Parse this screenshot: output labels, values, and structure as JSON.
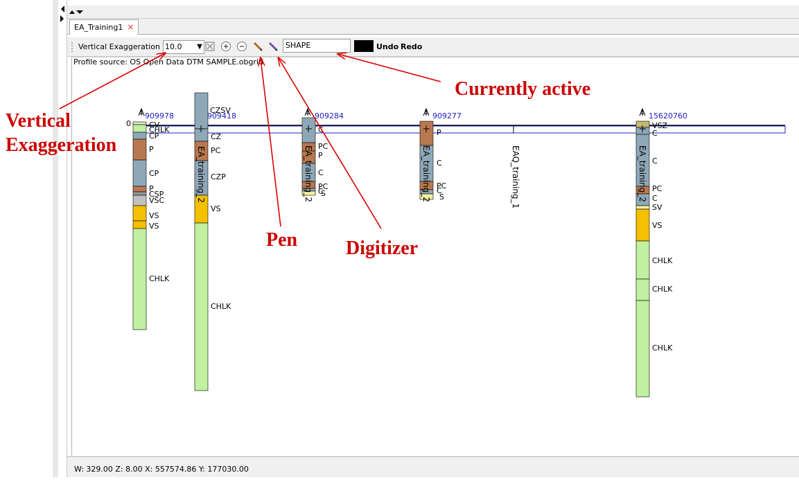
{
  "window": {
    "tab_label": "EA_Training1",
    "close_glyph": "×"
  },
  "toolbar": {
    "ve_label": "Vertical Exaggeration",
    "ve_value": "10.0",
    "shape_value": "SHAPE",
    "undo_label": "Undo",
    "redo_label": "Redo",
    "current_color": "#000000"
  },
  "icons": [
    "fit-extent-icon",
    "zoom-in-icon",
    "zoom-out-icon",
    "pen-icon",
    "digitizer-icon"
  ],
  "canvas": {
    "profile_source": "Profile source: OS Open Data DTM SAMPLE.obgrid",
    "depth_zero_label": "0"
  },
  "boreholes": [
    {
      "id": "909978",
      "layers": [
        {
          "code": "CV",
          "color": "#e0eac0"
        },
        {
          "code": "CHLK",
          "color": "#c0f0a0"
        },
        {
          "code": "CP",
          "color": "#8fa8b8"
        },
        {
          "code": "P",
          "color": "#b87850"
        },
        {
          "code": "CP",
          "color": "#8fa8b8"
        },
        {
          "code": "P",
          "color": "#b87850"
        },
        {
          "code": "CSP",
          "color": "#909898"
        },
        {
          "code": "VSC",
          "color": "#c0c0c0"
        },
        {
          "code": "VS",
          "color": "#f4c000"
        },
        {
          "code": "VS",
          "color": "#f4c000"
        },
        {
          "code": "CHLK",
          "color": "#c0f0a0"
        }
      ]
    },
    {
      "id": "909418",
      "name": "EA_training_2",
      "layers": [
        {
          "code": "CZSV",
          "color": "#8fa8b8"
        },
        {
          "code": "CZ",
          "color": "#8fa8b8"
        },
        {
          "code": "PC",
          "color": "#b87850"
        },
        {
          "code": "CZP",
          "color": "#8fa8b8"
        },
        {
          "code": "VS",
          "color": "#f4c000"
        },
        {
          "code": "CHLK",
          "color": "#c0f0a0"
        }
      ]
    },
    {
      "id": "909284",
      "name": "EA_training_2",
      "layers": [
        {
          "code": "C",
          "color": "#8fa8b8"
        },
        {
          "code": "PC",
          "color": "#b87850"
        },
        {
          "code": "P",
          "color": "#b87850"
        },
        {
          "code": "C",
          "color": "#8fa8b8"
        },
        {
          "code": "PC",
          "color": "#b87850"
        },
        {
          "code": "C",
          "color": "#8fa8b8"
        },
        {
          "code": "S",
          "color": "#f4f0a0"
        }
      ]
    },
    {
      "id": "909277",
      "name": "EA_training_2",
      "layers": [
        {
          "code": "P",
          "color": "#b87850"
        },
        {
          "code": "C",
          "color": "#8fa8b8"
        },
        {
          "code": "PC",
          "color": "#b87850"
        },
        {
          "code": "C",
          "color": "#8fa8b8"
        },
        {
          "code": "S",
          "color": "#f4f0a0"
        }
      ]
    },
    {
      "id": "15620760",
      "name": "EA_training_2",
      "layers": [
        {
          "code": "VSZ",
          "color": "#c8b870"
        },
        {
          "code": "C",
          "color": "#8fa8b8"
        },
        {
          "code": "C",
          "color": "#8fa8b8"
        },
        {
          "code": "PC",
          "color": "#b87850"
        },
        {
          "code": "C",
          "color": "#8fa8b8"
        },
        {
          "code": "SV",
          "color": "#f4f0a0"
        },
        {
          "code": "VS",
          "color": "#f4c000"
        },
        {
          "code": "CHLK",
          "color": "#c0f0a0"
        },
        {
          "code": "CHLK",
          "color": "#c0f0a0"
        },
        {
          "code": "CHLK",
          "color": "#c0f0a0"
        }
      ]
    }
  ],
  "section_label": "EAQ_training_1",
  "status": {
    "text": "W: 329.00 Z: 8.00 X: 557574.86 Y: 177030.00"
  },
  "annotations": {
    "ve": "Vertical Exaggeration",
    "pen": "Pen",
    "digitizer": "Digitizer",
    "active": "Currently active",
    "arrow_color": "#dd0000"
  }
}
